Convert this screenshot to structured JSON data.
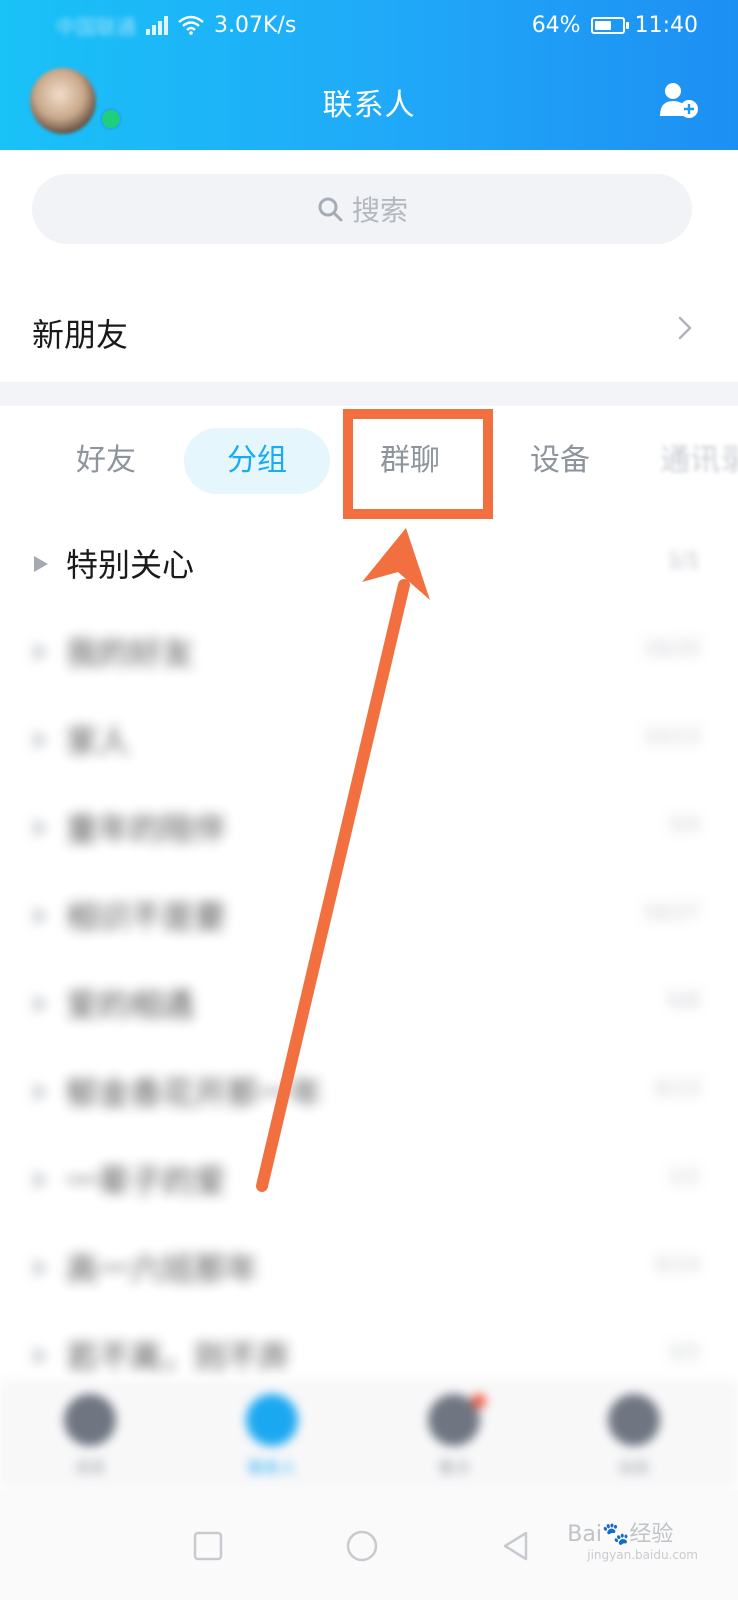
{
  "status_bar": {
    "carrier": "中国联通",
    "speed": "3.07K/s",
    "battery_percent": "64%",
    "battery_level": 0.64,
    "time": "11:40"
  },
  "header": {
    "title": "联系人",
    "add_contact_icon": "add-contact-icon",
    "avatar_status": "online"
  },
  "search": {
    "placeholder": "搜索",
    "icon": "search-icon"
  },
  "new_friends": {
    "label": "新朋友",
    "icon": "chevron-right-icon"
  },
  "tabs": [
    {
      "label": "好友",
      "active": false
    },
    {
      "label": "分组",
      "active": true
    },
    {
      "label": "群聊",
      "active": false,
      "highlighted": true
    },
    {
      "label": "设备",
      "active": false
    },
    {
      "label": "通讯录",
      "active": false
    }
  ],
  "groups": [
    {
      "name": "特别关心",
      "count": "1/1"
    },
    {
      "name": "我的好友",
      "count": "18/20"
    },
    {
      "name": "家人",
      "count": "10/13"
    },
    {
      "name": "童年的陪伴",
      "count": "3/4"
    },
    {
      "name": "相识不是要",
      "count": "16/27"
    },
    {
      "name": "爱的相遇",
      "count": "6/8"
    },
    {
      "name": "郁金香花开那一年",
      "count": "8/13"
    },
    {
      "name": "一辈子的爱",
      "count": "1/2"
    },
    {
      "name": "高一六班那年",
      "count": "6/14"
    },
    {
      "name": "若不离，则不弃",
      "count": "3/5"
    }
  ],
  "bottom_tabs": [
    {
      "label": "消息",
      "icon": "message-icon",
      "active": false
    },
    {
      "label": "联系人",
      "icon": "contacts-icon",
      "active": true
    },
    {
      "label": "看点",
      "icon": "eye-icon",
      "active": false,
      "badge": true
    },
    {
      "label": "动态",
      "icon": "star-icon",
      "active": false
    }
  ],
  "annotation": {
    "color": "#f2703f",
    "target": "群聊"
  },
  "watermark": {
    "brand": "Bai",
    "brand_suffix": "经验",
    "url": "jingyan.baidu.com"
  },
  "colors": {
    "header_start": "#19c2f7",
    "header_end": "#1d8ff3",
    "accent": "#19acf0",
    "annotation": "#f2703f"
  }
}
